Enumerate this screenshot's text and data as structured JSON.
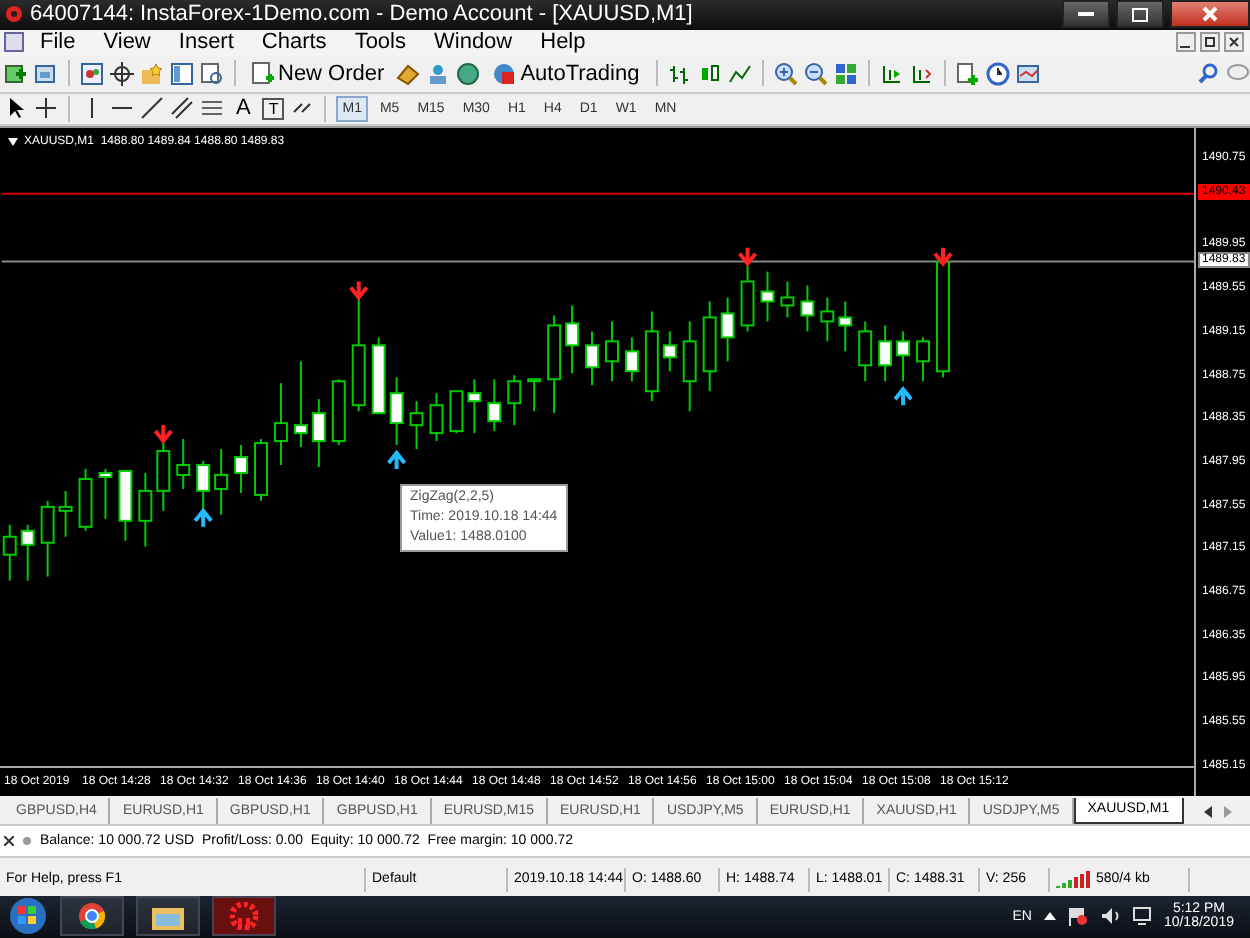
{
  "window": {
    "title": "64007144: InstaForex-1Demo.com - Demo Account - [XAUUSD,M1]"
  },
  "menu": [
    "File",
    "View",
    "Insert",
    "Charts",
    "Tools",
    "Window",
    "Help"
  ],
  "toolbar": {
    "new_order": "New Order",
    "auto_trading": "AutoTrading"
  },
  "toolbar2": {
    "letter_tools": [
      {
        "label": "A",
        "kind": "plain"
      },
      {
        "label": "T",
        "kind": "boxed"
      }
    ],
    "timeframes": [
      {
        "label": "M1",
        "selected": true
      },
      {
        "label": "M5",
        "selected": false
      },
      {
        "label": "M15",
        "selected": false
      },
      {
        "label": "M30",
        "selected": false
      },
      {
        "label": "H1",
        "selected": false
      },
      {
        "label": "H4",
        "selected": false
      },
      {
        "label": "D1",
        "selected": false
      },
      {
        "label": "W1",
        "selected": false
      },
      {
        "label": "MN",
        "selected": false
      }
    ]
  },
  "chart": {
    "header": "XAUUSD,M1  1488.80 1489.84 1488.80 1489.83",
    "price_axis": [
      "1490.75",
      "1489.95",
      "1489.55",
      "1489.15",
      "1488.75",
      "1488.35",
      "1487.95",
      "1487.55",
      "1487.15",
      "1486.75",
      "1486.35",
      "1485.95",
      "1485.55",
      "1485.15"
    ],
    "level_labels": [
      {
        "label": "1490.43",
        "kind": "alert"
      },
      {
        "label": "1489.83",
        "kind": "bid"
      }
    ],
    "time_axis": [
      "18 Oct 2019",
      "18 Oct 14:28",
      "18 Oct 14:32",
      "18 Oct 14:36",
      "18 Oct 14:40",
      "18 Oct 14:44",
      "18 Oct 14:48",
      "18 Oct 14:52",
      "18 Oct 14:56",
      "18 Oct 15:00",
      "18 Oct 15:04",
      "18 Oct 15:08",
      "18 Oct 15:12"
    ],
    "tooltip": [
      "ZigZag(2,2,5)",
      "Time: 2019.10.18 14:44",
      "Value1: 1488.0100"
    ]
  },
  "chart_tabs": [
    {
      "label": "GBPUSD,H4",
      "selected": false
    },
    {
      "label": "EURUSD,H1",
      "selected": false
    },
    {
      "label": "GBPUSD,H1",
      "selected": false
    },
    {
      "label": "GBPUSD,H1",
      "selected": false
    },
    {
      "label": "EURUSD,M15",
      "selected": false
    },
    {
      "label": "EURUSD,H1",
      "selected": false
    },
    {
      "label": "USDJPY,M5",
      "selected": false
    },
    {
      "label": "EURUSD,H1",
      "selected": false
    },
    {
      "label": "XAUUSD,H1",
      "selected": false
    },
    {
      "label": "USDJPY,M5",
      "selected": false
    },
    {
      "label": "XAUUSD,M1",
      "selected": true
    }
  ],
  "terminal": {
    "summary": "Balance: 10 000.72 USD  Profit/Loss: 0.00  Equity: 10 000.72  Free margin: 10 000.72"
  },
  "status_bar": [
    "For Help, press F1",
    "Default",
    "2019.10.18 14:44",
    "O: 1488.60",
    "H: 1488.74",
    "L: 1488.01",
    "C: 1488.31",
    "V: 256",
    "580/4 kb"
  ],
  "taskbar": {
    "language": "EN",
    "time": "5:12 PM",
    "date": "10/18/2019"
  }
}
